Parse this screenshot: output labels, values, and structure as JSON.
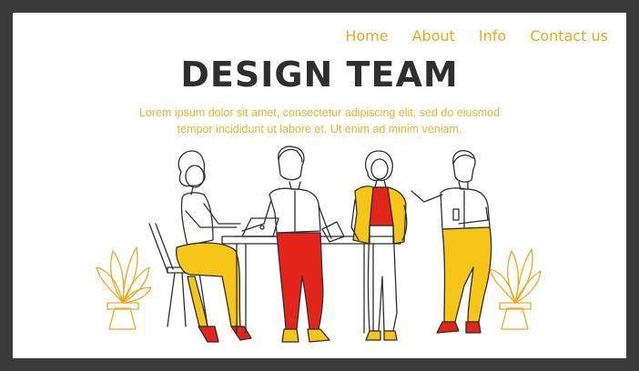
{
  "nav": {
    "items": [
      {
        "label": "Home"
      },
      {
        "label": "About"
      },
      {
        "label": "Info"
      },
      {
        "label": "Contact us"
      }
    ]
  },
  "hero": {
    "title": "DESIGN TEAM",
    "subtitle": "Lorem ipsum dolor sit amet, consectetur adipiscing elit, sed do eiusmod tempor incididunt ut labore et. Ut enim ad minim veniam."
  },
  "colors": {
    "frame": "#3a3a3a",
    "accent": "#f2a81d",
    "yellow": "#f5c518",
    "red": "#e3241b",
    "title": "#2f2f2f"
  },
  "illustration": {
    "icons": [
      "plant-icon",
      "woman-seated-icon",
      "laptop-icon",
      "man-red-pants-icon",
      "woman-yellow-jacket-icon",
      "man-yellow-pants-icon",
      "table-icon",
      "chair-icon"
    ]
  }
}
